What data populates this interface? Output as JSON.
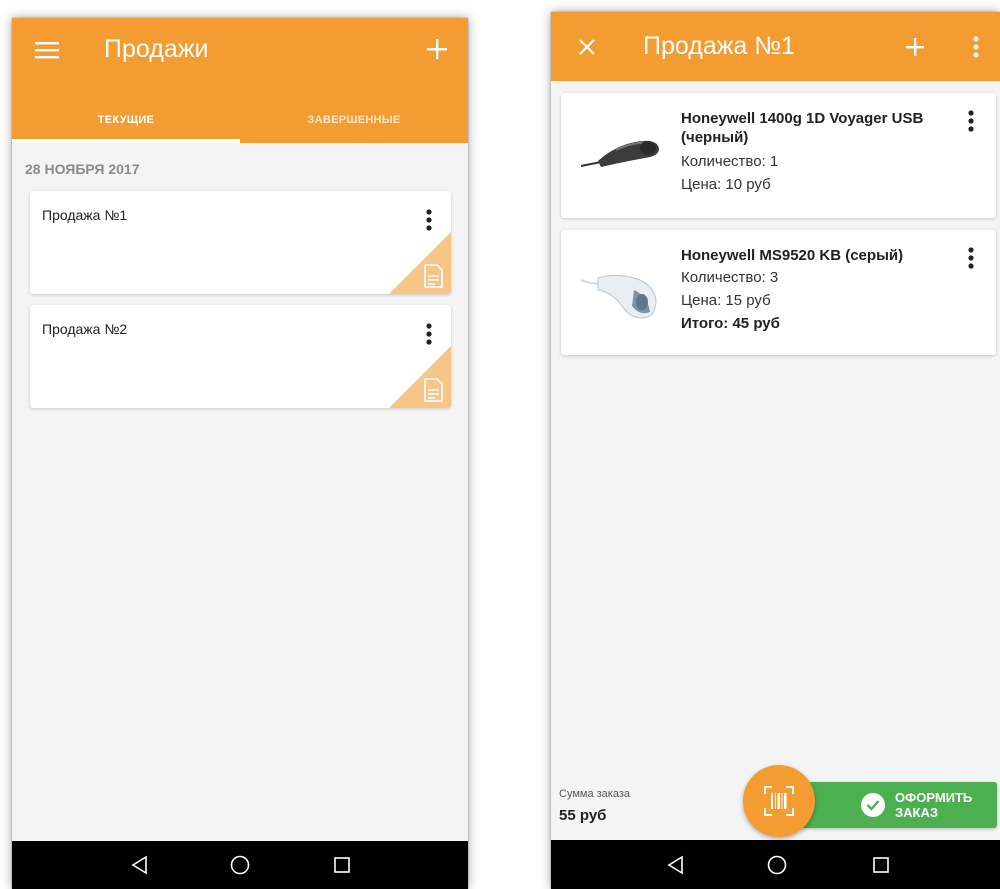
{
  "left_screen": {
    "title": "Продажи",
    "tabs": [
      {
        "label": "ТЕКУЩИЕ",
        "active": true
      },
      {
        "label": "ЗАВЕРШЕННЫЕ",
        "active": false
      }
    ],
    "date_header": "28 НОЯБРЯ 2017",
    "sales": [
      {
        "name": "Продажа №1"
      },
      {
        "name": "Продажа №2"
      }
    ],
    "icons": [
      "menu-icon",
      "plus-icon",
      "more-vert-icon",
      "document-icon"
    ]
  },
  "right_screen": {
    "title": "Продажа №1",
    "products": [
      {
        "name": "Honeywell 1400g 1D Voyager USB (черный)",
        "quantity": "Количество: 1",
        "price": "Цена: 10 руб",
        "total": ""
      },
      {
        "name": "Honeywell MS9520 KB (серый)",
        "quantity": "Количество: 3",
        "price": "Цена: 15 руб",
        "total": "Итого: 45 руб"
      }
    ],
    "sum_label": "Сумма заказа",
    "sum_value": "55 руб",
    "order_button": "ОФОРМИТЬ ЗАКАЗ",
    "icons": [
      "close-icon",
      "plus-icon",
      "more-vert-icon",
      "barcode-scan-icon",
      "check-circle-icon"
    ]
  },
  "navigation": {
    "icons": [
      "back-icon",
      "home-icon",
      "recents-icon"
    ]
  },
  "colors": {
    "accent": "#f39c31",
    "success": "#4caf50",
    "background": "#f4f4f4"
  }
}
